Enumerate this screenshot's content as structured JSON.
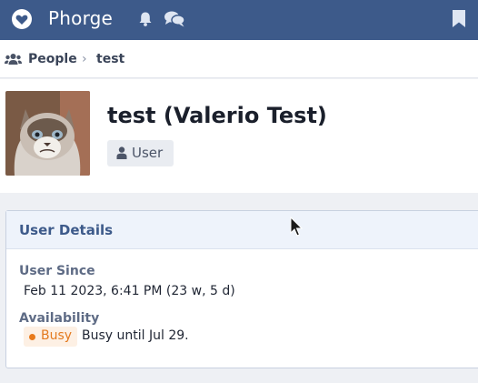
{
  "app": {
    "brand": "Phorge",
    "icons": {
      "logo": "heart-icon",
      "notifications": "bell-icon",
      "messages": "chat-icon",
      "quick": "bookmark-icon"
    }
  },
  "breadcrumb": {
    "items": [
      "People",
      "test"
    ],
    "separator": "›",
    "icon": "people-icon"
  },
  "profile": {
    "name": "test (Valerio Test)",
    "role": "User",
    "role_icon": "user-icon",
    "avatar": "cat-avatar"
  },
  "details": {
    "title": "User Details",
    "user_since_label": "User Since",
    "user_since_value": "Feb 11 2023, 6:41 PM (23 w, 5 d)",
    "availability_label": "Availability",
    "availability_status": "Busy",
    "availability_text": "Busy until Jul 29."
  },
  "colors": {
    "topbar": "#3d5a8a",
    "busy": "#e87a1b",
    "panel_header": "#eef3fb"
  }
}
